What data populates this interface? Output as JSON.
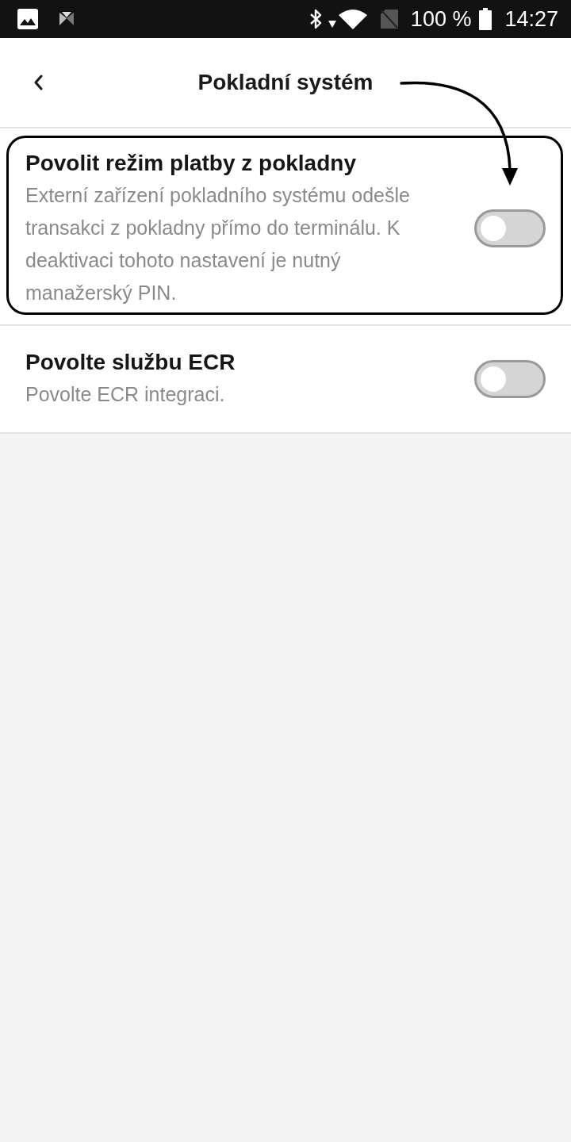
{
  "status_bar": {
    "battery": "100 %",
    "time": "14:27"
  },
  "header": {
    "title": "Pokladní systém"
  },
  "settings": [
    {
      "title": "Povolit režim platby z pokladny",
      "description": "Externí zařízení pokladního systému odešle transakci z pokladny přímo do terminálu. K deaktivaci tohoto nastavení je nutný manažerský PIN.",
      "on": false,
      "highlighted": true
    },
    {
      "title": "Povolte službu ECR",
      "description": "Povolte ECR integraci.",
      "on": false,
      "highlighted": false
    }
  ]
}
